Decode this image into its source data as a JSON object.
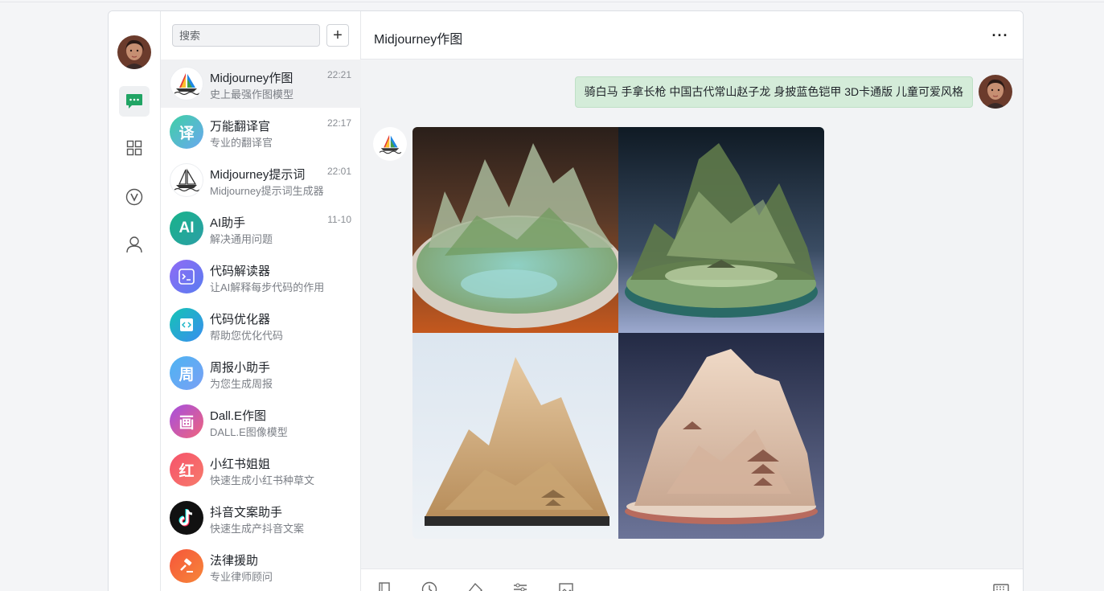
{
  "search": {
    "placeholder": "搜索",
    "add_label": "+"
  },
  "nav": {
    "items": [
      "chat-icon",
      "apps-icon",
      "v-logo-icon",
      "user-icon"
    ],
    "active": "chat-icon"
  },
  "conversations": [
    {
      "name": "Midjourney作图",
      "desc": "史上最强作图模型",
      "time": "22:21",
      "icon": "sailboat-rainbow-icon"
    },
    {
      "name": "万能翻译官",
      "desc": "专业的翻译官",
      "time": "22:17",
      "icon": "translate-icon",
      "avatar_text": "译",
      "color": "#4cc9a8"
    },
    {
      "name": "Midjourney提示词",
      "desc": "Midjourney提示词生成器",
      "time": "22:01",
      "icon": "sailboat-icon"
    },
    {
      "name": "AI助手",
      "desc": "解决通用问题",
      "time": "11-10",
      "icon": "ai-icon",
      "avatar_text": "AI",
      "color": "#20b487"
    },
    {
      "name": "代码解读器",
      "desc": "让AI解释每步代码的作用",
      "time": "",
      "icon": "terminal-icon",
      "color": "#7b6cf2"
    },
    {
      "name": "代码优化器",
      "desc": "帮助您优化代码",
      "time": "",
      "icon": "code-icon",
      "color": "#1fb6c9"
    },
    {
      "name": "周报小助手",
      "desc": "为您生成周报",
      "time": "",
      "icon": "weekly-icon",
      "avatar_text": "周",
      "color": "#5aa7f0"
    },
    {
      "name": "Dall.E作图",
      "desc": "DALL.E图像模型",
      "time": "",
      "icon": "paint-icon",
      "avatar_text": "画",
      "color": "#b24fd6"
    },
    {
      "name": "小红书姐姐",
      "desc": "快速生成小红书种草文",
      "time": "",
      "icon": "red-book-icon",
      "avatar_text": "红",
      "color": "#f5526b"
    },
    {
      "name": "抖音文案助手",
      "desc": "快速生成产抖音文案",
      "time": "",
      "icon": "tiktok-icon",
      "color": "#111111"
    },
    {
      "name": "法律援助",
      "desc": "专业律师顾问",
      "time": "",
      "icon": "gavel-icon",
      "color": "#f5553a"
    }
  ],
  "chat": {
    "title": "Midjourney作图",
    "more_label": "···",
    "user_message": "骑白马 手拿长枪 中国古代常山赵子龙 身披蓝色铠甲 3D卡通版 儿童可爱风格",
    "image_grid": [
      "misty-mountain-island-orange",
      "misty-mountain-island-blue",
      "sand-mountain-pagoda",
      "pink-mountain-pagoda"
    ]
  },
  "composer": {
    "tools": [
      "book-icon",
      "clock-icon",
      "eraser-icon",
      "sliders-icon",
      "image-icon",
      "keyboard-icon"
    ]
  },
  "colors": {
    "accent_green": "#20a464",
    "user_bubble": "#d4ecd9"
  }
}
